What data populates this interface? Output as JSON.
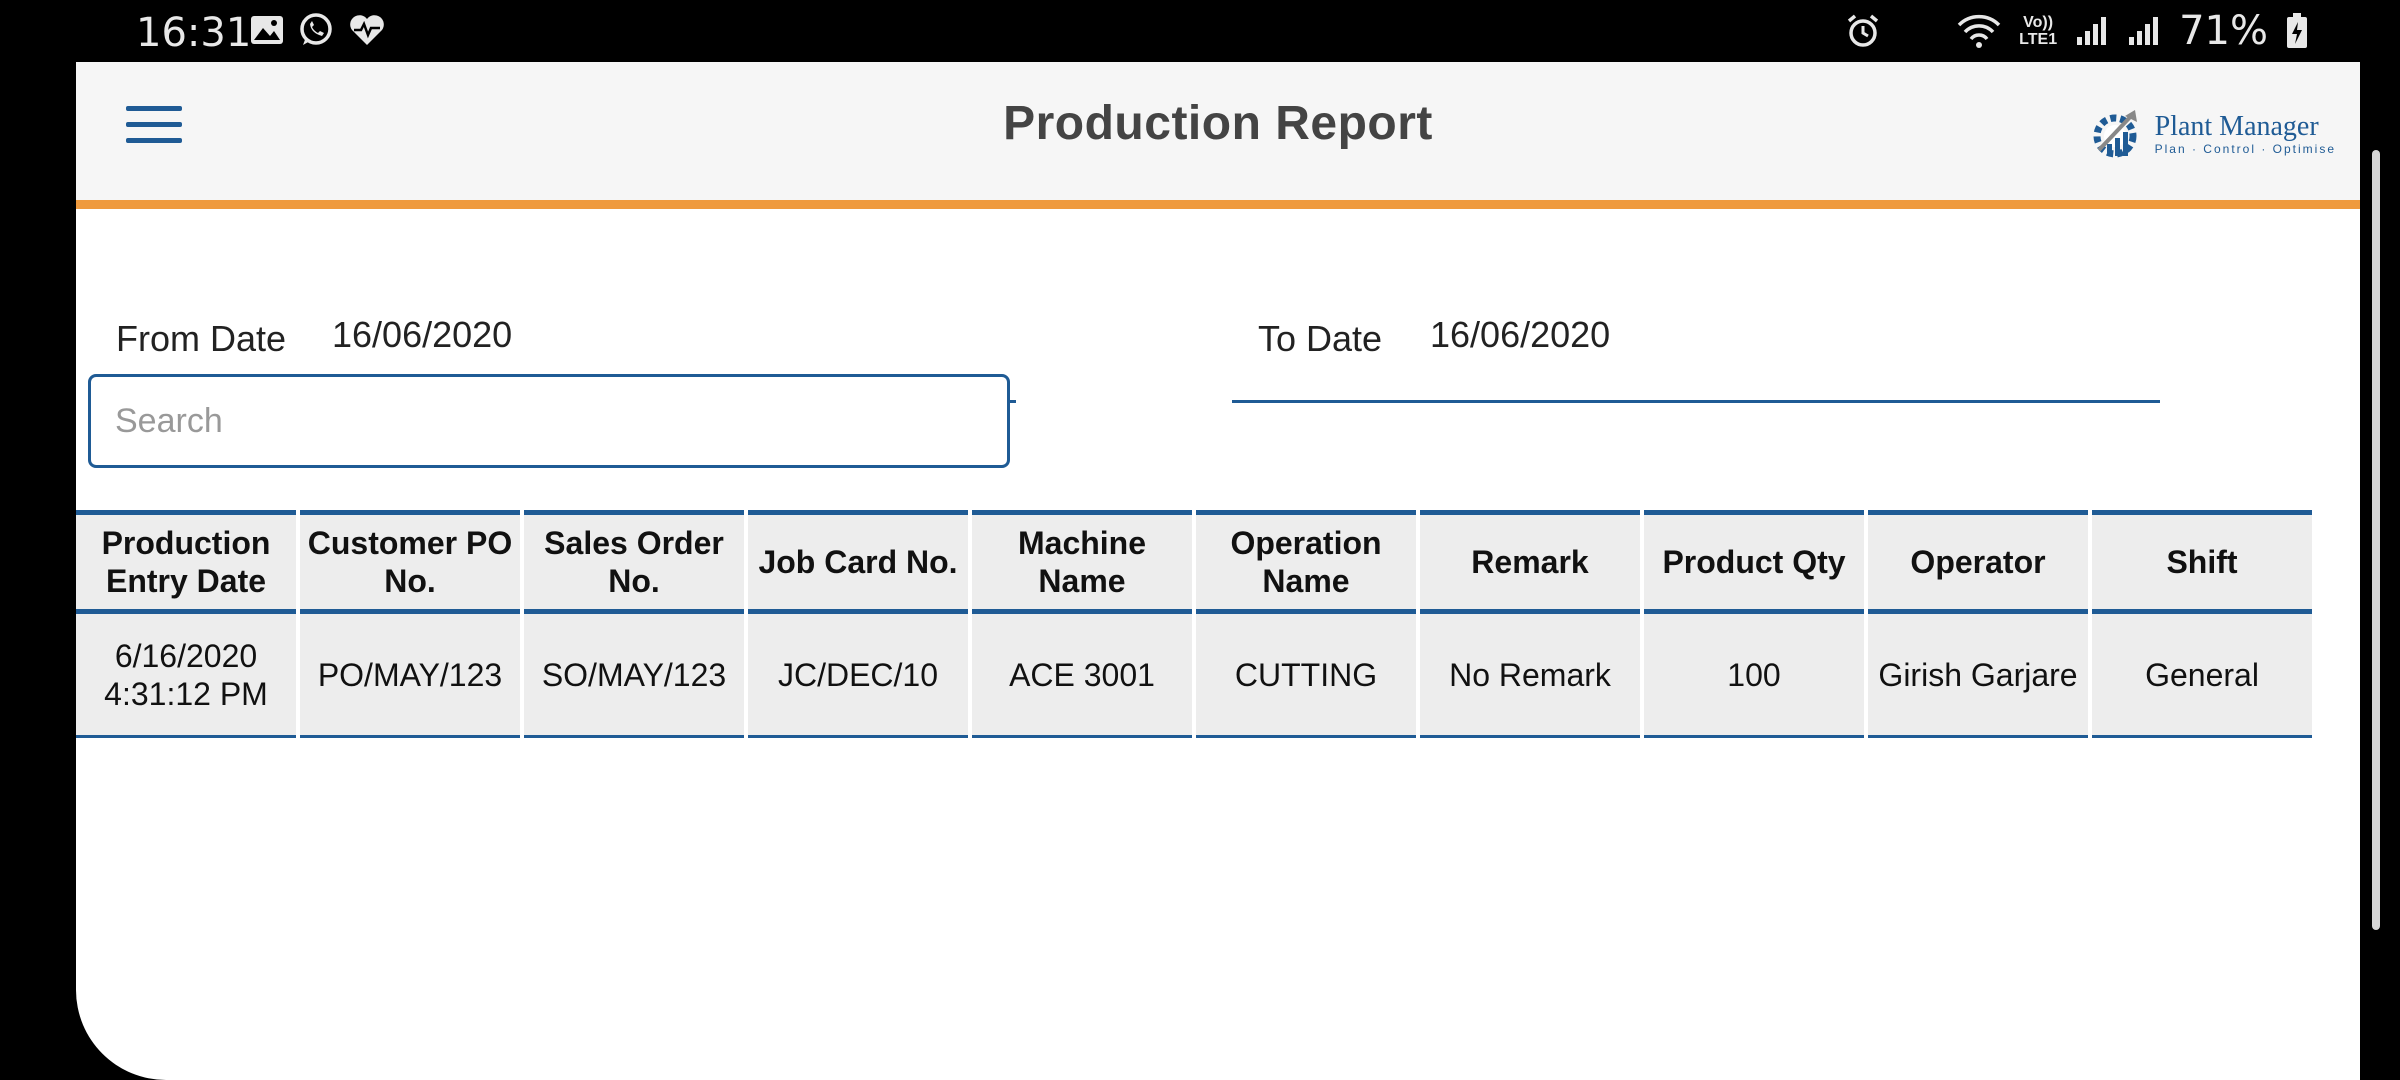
{
  "status_bar": {
    "time": "16:31",
    "left_icons": [
      "image-icon",
      "whatsapp-icon",
      "health-icon"
    ],
    "right_icons": [
      "alarm-icon",
      "wifi-icon",
      "volte-icon",
      "signal-icon",
      "signal-icon"
    ],
    "network_label": "VoLTE1",
    "battery": "71%"
  },
  "toolbar": {
    "title": "Production Report",
    "menu_icon": "hamburger-menu-icon",
    "logo": {
      "name": "Plant Manager",
      "tagline": "Plan · Control · Optimise"
    }
  },
  "filters": {
    "from_date_label": "From Date",
    "from_date_value": "16/06/2020",
    "to_date_label": "To Date",
    "to_date_value": "16/06/2020",
    "search_placeholder": "Search"
  },
  "table": {
    "headers": [
      "Production Entry Date",
      "Customer PO No.",
      "Sales Order No.",
      "Job Card No.",
      "Machine Name",
      "Operation Name",
      "Remark",
      "Product Qty",
      "Operator",
      "Shift"
    ],
    "rows": [
      [
        "6/16/2020 4:31:12 PM",
        "PO/MAY/123",
        "SO/MAY/123",
        "JC/DEC/10",
        "ACE 3001",
        "CUTTING",
        "No Remark",
        "100",
        "Girish Garjare",
        "General"
      ]
    ]
  },
  "colors": {
    "accent": "#1f5b95",
    "toolbar_underline": "#ef9a3e"
  }
}
